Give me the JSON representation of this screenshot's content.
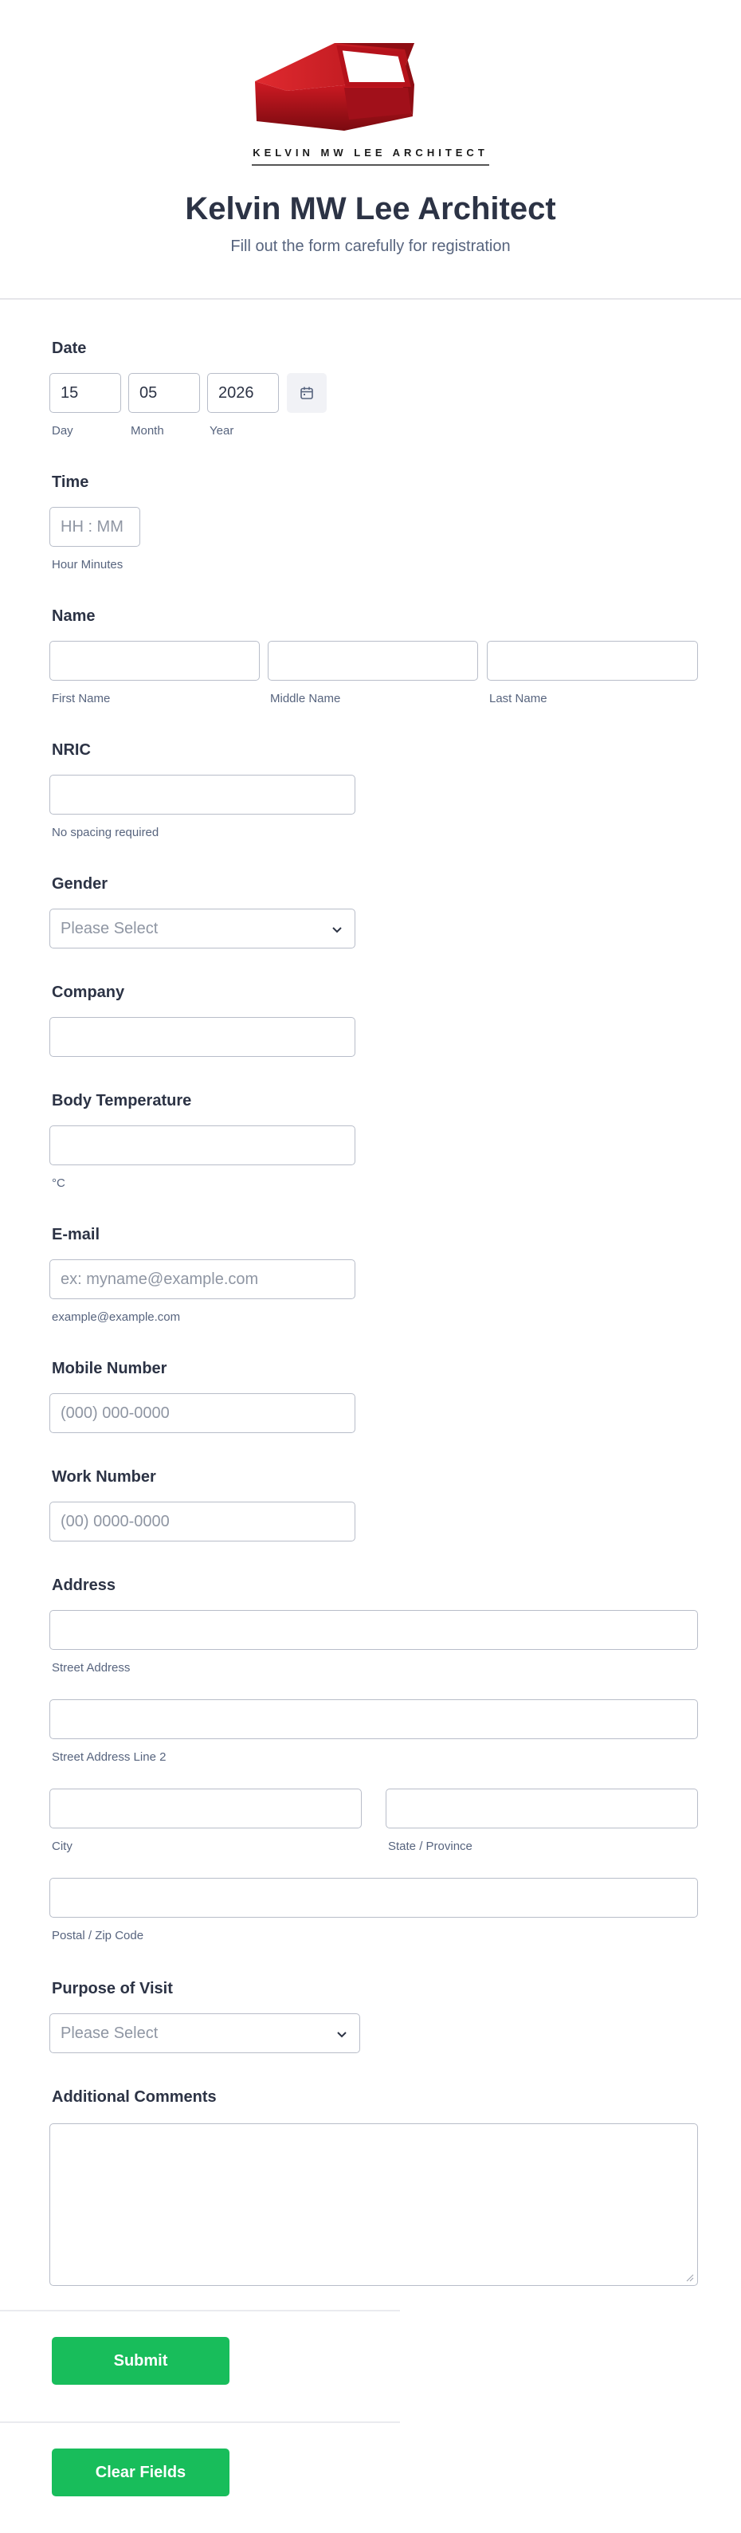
{
  "header": {
    "logo_text": "KELVIN MW LEE ARCHITECT",
    "title": "Kelvin MW Lee Architect",
    "subtitle": "Fill out the form carefully for registration"
  },
  "fields": {
    "date": {
      "label": "Date",
      "day_value": "15",
      "month_value": "05",
      "year_value": "2026",
      "day_sublabel": "Day",
      "month_sublabel": "Month",
      "year_sublabel": "Year",
      "icon": "calendar-icon"
    },
    "time": {
      "label": "Time",
      "placeholder": "HH : MM",
      "sublabel": "Hour Minutes"
    },
    "name": {
      "label": "Name",
      "first_sublabel": "First Name",
      "middle_sublabel": "Middle Name",
      "last_sublabel": "Last Name"
    },
    "nric": {
      "label": "NRIC",
      "sublabel": "No spacing required"
    },
    "gender": {
      "label": "Gender",
      "selected": "Please Select"
    },
    "company": {
      "label": "Company"
    },
    "temperature": {
      "label": "Body Temperature",
      "sublabel": "°C"
    },
    "email": {
      "label": "E-mail",
      "placeholder": "ex: myname@example.com",
      "sublabel": "example@example.com"
    },
    "mobile": {
      "label": "Mobile Number",
      "placeholder": "(000) 000-0000"
    },
    "work": {
      "label": "Work Number",
      "placeholder": "(00) 0000-0000"
    },
    "address": {
      "label": "Address",
      "street_sublabel": "Street Address",
      "street2_sublabel": "Street Address Line 2",
      "city_sublabel": "City",
      "state_sublabel": "State / Province",
      "postal_sublabel": "Postal / Zip Code"
    },
    "purpose": {
      "label": "Purpose of Visit",
      "selected": "Please Select"
    },
    "comments": {
      "label": "Additional Comments"
    }
  },
  "buttons": {
    "submit": "Submit",
    "clear": "Clear Fields"
  },
  "colors": {
    "accent": "#18bd5b",
    "logo_red": "#b5121b",
    "text": "#2c3345",
    "sublabel": "#57647e"
  }
}
